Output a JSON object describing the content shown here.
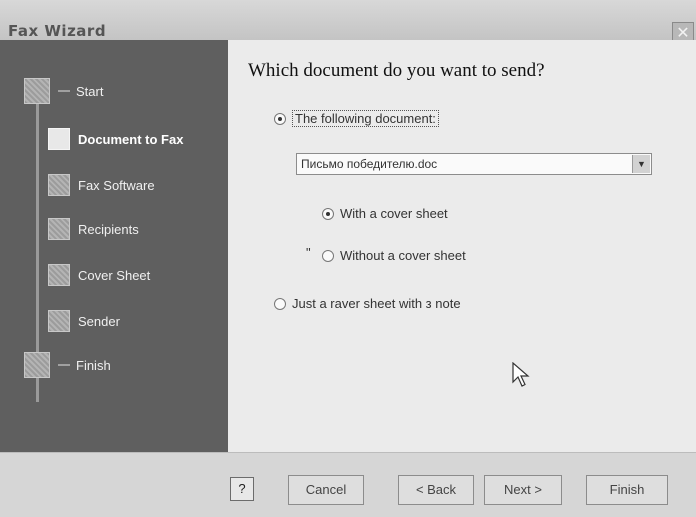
{
  "window": {
    "title": "Fax Wizard",
    "close_glyph": "✕"
  },
  "sidebar": {
    "steps": [
      {
        "label": "Start"
      },
      {
        "label": "Document to Fax"
      },
      {
        "label": "Fax Software"
      },
      {
        "label": "Recipients"
      },
      {
        "label": "Cover Sheet"
      },
      {
        "label": "Sender"
      },
      {
        "label": "Finish"
      }
    ]
  },
  "main": {
    "question": "Which document do you want to send?",
    "option_following": "The following document:",
    "document_value": "Письмо победителю.doc",
    "combo_arrow": "▼",
    "option_with_cover": "With a cover sheet",
    "option_without_cover": "Without a cover sheet",
    "stray_mark": "\"",
    "option_just_cover": "Just a raver sheet with з note"
  },
  "footer": {
    "help": "?",
    "cancel": "Cancel",
    "back": "< Back",
    "next": "Next >",
    "finish": "Finish"
  }
}
